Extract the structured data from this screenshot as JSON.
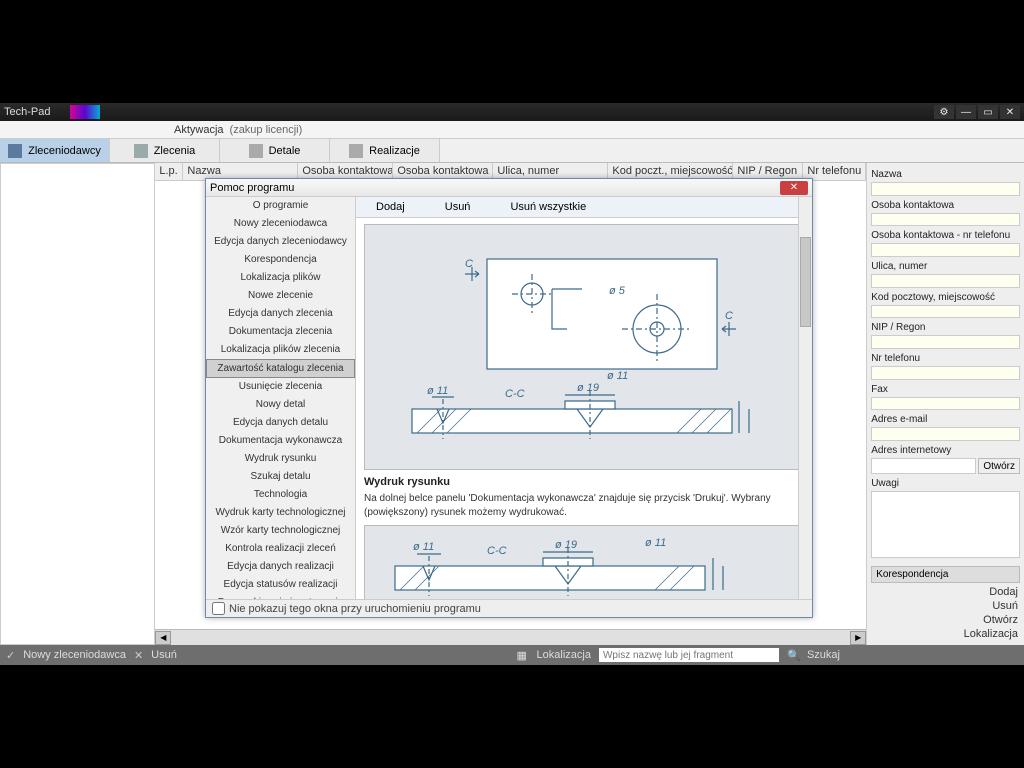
{
  "window": {
    "title": "Tech-Pad"
  },
  "menubar": {
    "item1": "Aktywacja",
    "item2": "(zakup licencji)"
  },
  "tabs": [
    {
      "label": "Zleceniodawcy"
    },
    {
      "label": "Zlecenia"
    },
    {
      "label": "Detale"
    },
    {
      "label": "Realizacje"
    }
  ],
  "columns": {
    "lp": "L.p.",
    "nazwa": "Nazwa",
    "osoba": "Osoba kontaktowa",
    "osoba_tel": "Osoba kontaktowa - t",
    "ulica": "Ulica, numer",
    "kod": "Kod poczt., miejscowość",
    "nip": "NIP / Regon",
    "tel": "Nr telefonu"
  },
  "right": {
    "nazwa": "Nazwa",
    "osoba": "Osoba kontaktowa",
    "osoba_tel": "Osoba kontaktowa - nr telefonu",
    "ulica": "Ulica, numer",
    "kod": "Kod pocztowy, miejscowość",
    "nip": "NIP / Regon",
    "tel": "Nr telefonu",
    "fax": "Fax",
    "email": "Adres e-mail",
    "www": "Adres internetowy",
    "open": "Otwórz",
    "uwagi": "Uwagi",
    "kores": "Korespondencja",
    "links": {
      "dodaj": "Dodaj",
      "usun": "Usuń",
      "otworz": "Otwórz",
      "lokal": "Lokalizacja"
    }
  },
  "status": {
    "nowy": "Nowy zleceniodawca",
    "usun": "Usuń",
    "lokal": "Lokalizacja",
    "placeholder": "Wpisz nazwę lub jej fragment",
    "szukaj": "Szukaj"
  },
  "dialog": {
    "title": "Pomoc programu",
    "nav": [
      "O programie",
      "Nowy zleceniodawca",
      "Edycja danych zleceniodawcy",
      "Korespondencja",
      "Lokalizacja plików",
      "Nowe zlecenie",
      "Edycja danych zlecenia",
      "Dokumentacja zlecenia",
      "Lokalizacja plików zlecenia",
      "Zawartość katalogu zlecenia",
      "Usunięcie zlecenia",
      "Nowy detal",
      "Edycja danych detalu",
      "Dokumentacja wykonawcza",
      "Wydruk rysunku",
      "Szukaj detalu",
      "Technologia",
      "Wydruk karty technologicznej",
      "Wzór karty technologicznej",
      "Kontrola realizacji zleceń",
      "Edycja danych realizacji",
      "Edycja statusów realizacji",
      "Przeszukiwanie i sortowanie"
    ],
    "nav_selected": 9,
    "topbtns": {
      "dodaj": "Dodaj",
      "usun": "Usuń",
      "usunw": "Usuń wszystkie"
    },
    "heading": "Wydruk rysunku",
    "body": "Na dolnej belce panelu 'Dokumentacja wykonawcza' znajduje się przycisk 'Drukuj'. Wybrany (powiększony) rysunek możemy wydrukować.",
    "dims": {
      "d11": "ø 11",
      "d19": "ø 19",
      "d5": "ø 5",
      "cc": "C-C",
      "c": "C"
    },
    "footer_chk": "Nie pokazuj tego okna przy uruchomieniu programu"
  }
}
